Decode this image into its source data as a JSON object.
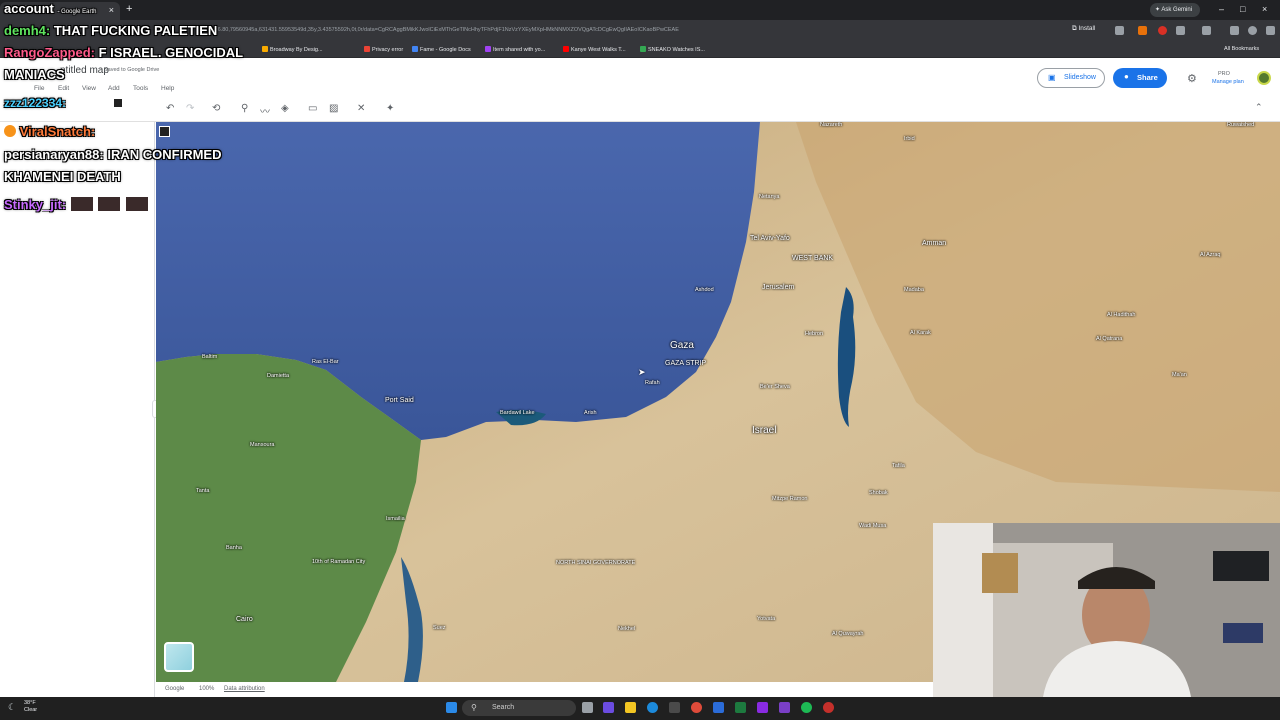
{
  "browser": {
    "tab_title": "Google Earth",
    "url": "...76.80,79560945a,631431.55953549d,35y,3.43575592h,0t,0r/data=CgRCAggBMikKJwolCiExMThGeTlNcHhyTFhPdjF1NzVzYXEyMXpHMkNNMXZOVQgATcDCgEwQgIIAEoICKaoBPwCEAE",
    "install_label": "Install",
    "ask_gemini_label": "Ask Gemini",
    "all_bookmarks_label": "All Bookmarks",
    "bookmarks": [
      {
        "label": "Broadway By Desig...",
        "color": "#f9ab00"
      },
      {
        "label": "Privacy error",
        "color": "#ea4335"
      },
      {
        "label": "Fame - Google Docs",
        "color": "#4285f4"
      },
      {
        "label": "Item shared with yo...",
        "color": "#a142f4"
      },
      {
        "label": "Kanye West Walks T...",
        "color": "#ff0000"
      },
      {
        "label": "SNEAKO Watches IS...",
        "color": "#34a853"
      }
    ]
  },
  "earth": {
    "map_name": "ntitled map",
    "saved_status": "Saved to Google Drive",
    "menu": [
      "File",
      "Edit",
      "View",
      "Add",
      "Tools",
      "Help"
    ],
    "slideshow_label": "Slideshow",
    "share_label": "Share",
    "plan_badge": "PRO",
    "manage_plan_label": "Manage plan"
  },
  "map_labels": {
    "gaza": "Gaza",
    "gaza_strip": "GAZA STRIP",
    "israel": "Israel",
    "west_bank": "WEST BANK",
    "jerusalem": "Jerusalem",
    "tel_aviv": "Tel Aviv-Yafo",
    "ashdod": "Ashdod",
    "netanya": "Netanya",
    "hebron": "Hebron",
    "beer_sheva": "Be'er Sheva",
    "rafah": "Rafah",
    "amman": "Amman",
    "madaba": "Madaba",
    "irbid": "Irbid",
    "nazareth": "Nazareth",
    "port_said": "Port Said",
    "bardawil": "Bardawil Lake",
    "arish": "Arish",
    "damietta": "Damietta",
    "ras_el_bar": "Ras El-Bar",
    "baltim": "Baltim",
    "mansoura": "Mansoura",
    "tanta": "Tanta",
    "banha": "Banha",
    "cairo": "Cairo",
    "ismailia": "Ismailia",
    "tenth_ramadan": "10th of Ramadan City",
    "suez": "Suez",
    "north_sinai": "NORTH SINAI GOVERNORATE",
    "nekhel": "Nekhel",
    "mitzpe_ramon": "Mitzpe Ramon",
    "shobak": "Shobak",
    "wadi_musa": "Wadi Musa",
    "al_karak": "Al Karak",
    "tafila": "Tafila",
    "rawished": "Ruwaished",
    "azraq": "Al Azraq",
    "qatrana": "Al Qatrana",
    "hadithah": "Al Hadithah",
    "yoventa": "Yotvata",
    "quwayrah": "Al Quwayrah",
    "ma_an": "Ma'an"
  },
  "map_footer": {
    "attribution": "Google",
    "scale": "100%",
    "data_label": "Data attribution"
  },
  "chat": {
    "line1_user": "account",
    "line1_source": "- Google Earth",
    "line2_user": "demh4:",
    "line2_text": "THAT FUCKING PALETIEN",
    "line3_user": "RangoZapped:",
    "line3_text": "F ISRAEL. GENOCIDAL",
    "line3b_text": "MANIACS",
    "line4_user": "zzz122334:",
    "line5_user": "ViralSnatch:",
    "line6_user": "persianaryan88:",
    "line6_text": "IRAN CONFIRMED",
    "line6b_text": "KHAMENEI DEATH",
    "line7_user": "Stinky_jit:"
  },
  "taskbar": {
    "temp": "38°F",
    "weather": "Clear",
    "search_placeholder": "Search"
  },
  "colors": {
    "sea": "#3f5fa3",
    "land": "#d8c39a",
    "delta": "#4e8a3c",
    "share": "#1a73e8"
  }
}
